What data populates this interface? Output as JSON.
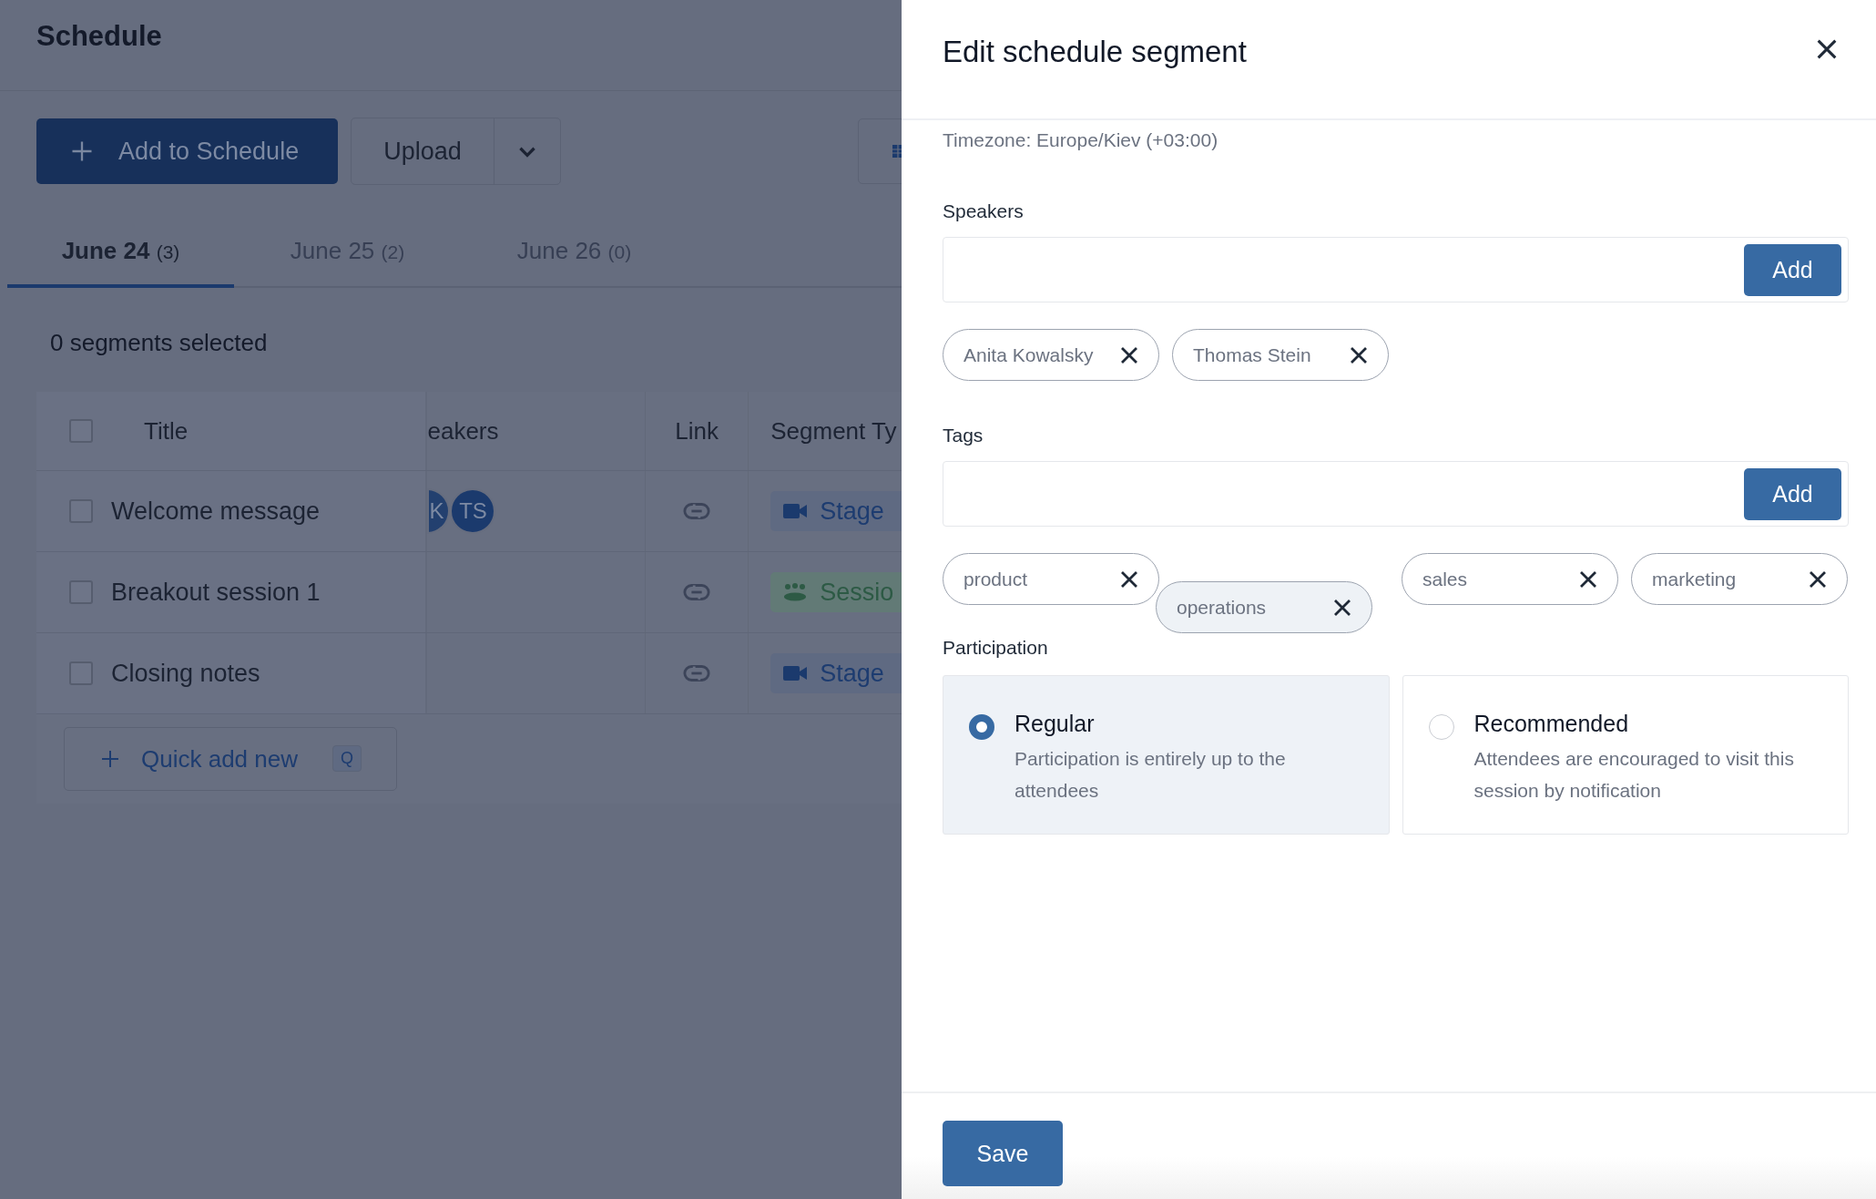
{
  "page": {
    "title": "Schedule"
  },
  "toolbar": {
    "add_button": "Add to Schedule",
    "upload_button": "Upload"
  },
  "tabs": [
    {
      "label": "June 24",
      "count": "(3)",
      "selected": true
    },
    {
      "label": "June 25",
      "count": "(2)",
      "selected": false
    },
    {
      "label": "June 26",
      "count": "(0)",
      "selected": false
    }
  ],
  "selection_status": "0 segments selected",
  "table": {
    "header_checked": false,
    "columns": [
      "Title",
      "eakers",
      "Link",
      "Segment Ty"
    ],
    "rows": [
      {
        "title": "Welcome message",
        "checked": false,
        "speakers": [
          {
            "initials": "K",
            "clipped": true
          },
          {
            "initials": "TS",
            "clipped": false
          }
        ],
        "segment_type": {
          "kind": "stage",
          "label": "Stage"
        }
      },
      {
        "title": "Breakout session 1",
        "checked": false,
        "speakers": [],
        "segment_type": {
          "kind": "session",
          "label": "Sessio"
        }
      },
      {
        "title": "Closing notes",
        "checked": false,
        "speakers": [],
        "segment_type": {
          "kind": "stage",
          "label": "Stage"
        }
      }
    ]
  },
  "quick_add": {
    "label": "Quick add new",
    "shortcut": "Q"
  },
  "panel": {
    "title": "Edit schedule segment",
    "timezone": "Timezone: Europe/Kiev (+03:00)",
    "speakers": {
      "label": "Speakers",
      "add_button": "Add",
      "chips": [
        {
          "label": "Anita Kowalsky",
          "dragging": false
        },
        {
          "label": "Thomas Stein",
          "dragging": false
        }
      ]
    },
    "tags": {
      "label": "Tags",
      "add_button": "Add",
      "chips": [
        {
          "label": "product",
          "dragging": false
        },
        {
          "label": "operations",
          "dragging": true
        },
        {
          "label": "sales",
          "dragging": false
        },
        {
          "label": "marketing",
          "dragging": false
        }
      ]
    },
    "participation": {
      "label": "Participation",
      "options": [
        {
          "title": "Regular",
          "description": "Participation is entirely up to the attendees",
          "selected": true
        },
        {
          "title": "Recommended",
          "description": "Attendees are encouraged to visit this session by notification",
          "selected": false
        }
      ]
    },
    "save_button": "Save"
  }
}
